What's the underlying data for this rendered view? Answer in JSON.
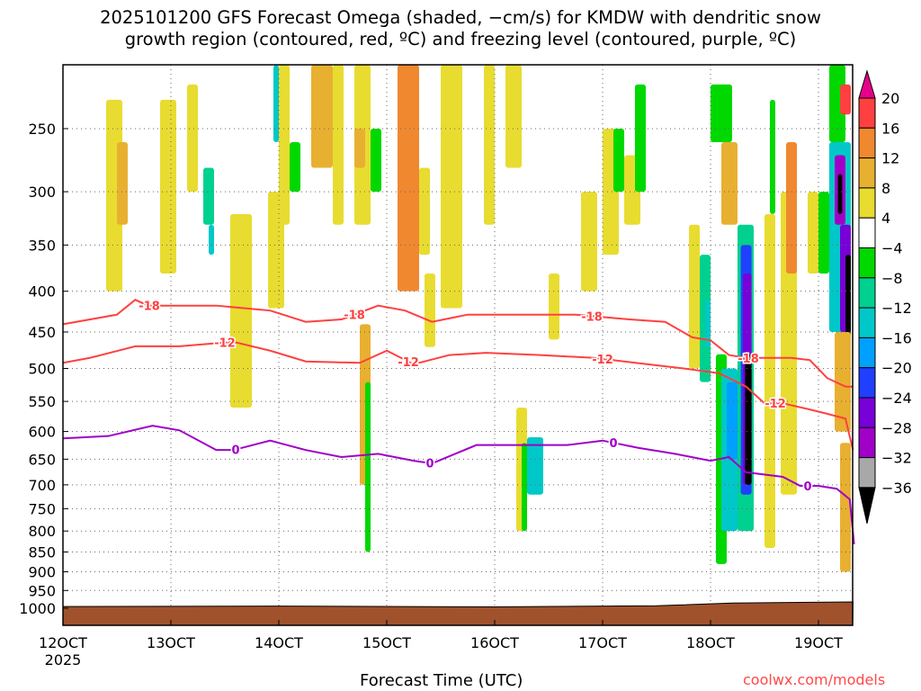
{
  "title": {
    "line1": "2025101200 GFS Forecast Omega (shaded, −cm/s) for KMDW with dendritic snow",
    "line2": "growth region (contoured, red, ºC) and freezing level (contoured, purple, ºC)"
  },
  "credit": "coolwx.com/models",
  "chart_data": {
    "type": "heatmap",
    "title": "2025101200 GFS Forecast Omega (shaded, −cm/s) for KMDW with dendritic snow growth region (contoured, red, ºC) and freezing level (contoured, purple, ºC)",
    "xlabel": "Forecast Time (UTC)",
    "ylabel": "",
    "xlim": [
      12.0,
      19.32
    ],
    "ylim_hpa": [
      1050,
      208
    ],
    "y_scale": "log",
    "x_ticks": [
      {
        "value": 12,
        "label": "12OCT"
      },
      {
        "value": 13,
        "label": "13OCT"
      },
      {
        "value": 14,
        "label": "14OCT"
      },
      {
        "value": 15,
        "label": "15OCT"
      },
      {
        "value": 16,
        "label": "16OCT"
      },
      {
        "value": 17,
        "label": "17OCT"
      },
      {
        "value": 18,
        "label": "18OCT"
      },
      {
        "value": 19,
        "label": "19OCT"
      }
    ],
    "x_sublabel": "2025",
    "y_ticks": [
      250,
      300,
      350,
      400,
      450,
      500,
      550,
      600,
      650,
      700,
      750,
      800,
      850,
      900,
      950,
      1000
    ],
    "grid": true,
    "colorbar": {
      "levels": [
        20,
        16,
        12,
        8,
        4,
        -4,
        -8,
        -12,
        -16,
        -20,
        -24,
        -28,
        -32,
        -36
      ],
      "colors": [
        "#e8008a",
        "#ff4040",
        "#f08830",
        "#e8b030",
        "#e8dc30",
        "#ffffff",
        "#00d800",
        "#00d090",
        "#00c8c8",
        "#00a0ff",
        "#2040ff",
        "#7800d8",
        "#a000c8",
        "#a8a8a8",
        "#000000"
      ]
    },
    "ground_color": "#a0522d",
    "surface_pressure": {
      "x": [
        12.0,
        14.0,
        16.0,
        17.5,
        18.2,
        19.32
      ],
      "p": [
        995,
        994,
        996,
        993,
        985,
        982
      ]
    },
    "contours": [
      {
        "name": "-18",
        "label": "-18",
        "color": "#ff4040",
        "x": [
          12.0,
          12.5,
          12.67,
          12.79,
          13.08,
          13.42,
          13.92,
          14.25,
          14.58,
          14.92,
          15.17,
          15.42,
          15.75,
          16.25,
          16.75,
          17.25,
          17.58,
          17.83,
          18.0,
          18.17,
          18.33,
          18.5,
          18.75,
          18.92,
          19.08,
          19.25,
          19.32
        ],
        "p": [
          440,
          428,
          410,
          417,
          417,
          417,
          423,
          437,
          434,
          417,
          423,
          437,
          428,
          428,
          428,
          434,
          437,
          457,
          461,
          481,
          485,
          485,
          485,
          488,
          514,
          527,
          527
        ],
        "labels_at": [
          12.8,
          14.7,
          16.9,
          18.35
        ]
      },
      {
        "name": "-12",
        "label": "-12",
        "color": "#ff4040",
        "x": [
          12.0,
          12.25,
          12.67,
          13.08,
          13.58,
          13.92,
          14.25,
          14.75,
          15.0,
          15.25,
          15.58,
          15.92,
          16.42,
          16.92,
          17.42,
          17.75,
          18.08,
          18.33,
          18.5,
          18.67,
          18.92,
          19.08,
          19.25,
          19.32
        ],
        "p": [
          492,
          485,
          469,
          469,
          463,
          475,
          490,
          492,
          475,
          494,
          481,
          478,
          481,
          485,
          494,
          500,
          507,
          527,
          553,
          553,
          563,
          570,
          578,
          633
        ],
        "labels_at": [
          13.5,
          15.2,
          17.0,
          18.6
        ]
      },
      {
        "name": "0",
        "label": "0",
        "color": "#a000c8",
        "x": [
          12.0,
          12.42,
          12.83,
          13.08,
          13.42,
          13.58,
          13.92,
          14.25,
          14.58,
          14.92,
          15.25,
          15.42,
          15.83,
          16.17,
          16.67,
          17.0,
          17.33,
          17.67,
          18.0,
          18.17,
          18.33,
          18.67,
          18.83,
          19.0,
          19.17,
          19.29,
          19.33
        ],
        "p": [
          612,
          608,
          590,
          598,
          633,
          633,
          616,
          633,
          646,
          640,
          653,
          658,
          624,
          624,
          624,
          616,
          629,
          640,
          653,
          646,
          675,
          684,
          702,
          702,
          708,
          730,
          831
        ],
        "labels_at": [
          13.6,
          15.4,
          17.1,
          18.9
        ]
      }
    ],
    "omega_patches": [
      {
        "x": [
          12.4,
          12.55
        ],
        "p": [
          230,
          400
        ],
        "value": 6
      },
      {
        "x": [
          12.5,
          12.6
        ],
        "p": [
          260,
          330
        ],
        "value": 10
      },
      {
        "x": [
          12.9,
          13.05
        ],
        "p": [
          230,
          380
        ],
        "value": 6
      },
      {
        "x": [
          13.15,
          13.25
        ],
        "p": [
          220,
          300
        ],
        "value": 6
      },
      {
        "x": [
          13.3,
          13.4
        ],
        "p": [
          280,
          330
        ],
        "value": -10
      },
      {
        "x": [
          13.35,
          13.4
        ],
        "p": [
          330,
          360
        ],
        "value": -16
      },
      {
        "x": [
          13.55,
          13.75
        ],
        "p": [
          320,
          560
        ],
        "value": 6
      },
      {
        "x": [
          13.9,
          14.05
        ],
        "p": [
          300,
          420
        ],
        "value": 6
      },
      {
        "x": [
          13.95,
          14.0
        ],
        "p": [
          208,
          260
        ],
        "value": -14
      },
      {
        "x": [
          14.0,
          14.1
        ],
        "p": [
          208,
          330
        ],
        "value": 6
      },
      {
        "x": [
          14.1,
          14.2
        ],
        "p": [
          260,
          300
        ],
        "value": -6
      },
      {
        "x": [
          14.3,
          14.5
        ],
        "p": [
          208,
          280
        ],
        "value": 10
      },
      {
        "x": [
          14.5,
          14.6
        ],
        "p": [
          208,
          330
        ],
        "value": 6
      },
      {
        "x": [
          14.7,
          14.85
        ],
        "p": [
          208,
          330
        ],
        "value": 6
      },
      {
        "x": [
          14.7,
          14.8
        ],
        "p": [
          250,
          280
        ],
        "value": 10
      },
      {
        "x": [
          14.75,
          14.85
        ],
        "p": [
          440,
          700
        ],
        "value": 8
      },
      {
        "x": [
          14.8,
          14.85
        ],
        "p": [
          520,
          850
        ],
        "value": -8
      },
      {
        "x": [
          14.85,
          14.95
        ],
        "p": [
          250,
          300
        ],
        "value": -6
      },
      {
        "x": [
          15.1,
          15.3
        ],
        "p": [
          208,
          400
        ],
        "value": 12
      },
      {
        "x": [
          15.3,
          15.4
        ],
        "p": [
          280,
          360
        ],
        "value": 6
      },
      {
        "x": [
          15.35,
          15.45
        ],
        "p": [
          380,
          470
        ],
        "value": 6
      },
      {
        "x": [
          15.5,
          15.7
        ],
        "p": [
          208,
          420
        ],
        "value": 6
      },
      {
        "x": [
          15.9,
          16.0
        ],
        "p": [
          208,
          330
        ],
        "value": 6
      },
      {
        "x": [
          16.1,
          16.25
        ],
        "p": [
          208,
          280
        ],
        "value": 6
      },
      {
        "x": [
          16.2,
          16.3
        ],
        "p": [
          560,
          800
        ],
        "value": 6
      },
      {
        "x": [
          16.25,
          16.3
        ],
        "p": [
          620,
          800
        ],
        "value": -6
      },
      {
        "x": [
          16.3,
          16.45
        ],
        "p": [
          610,
          720
        ],
        "value": -14
      },
      {
        "x": [
          16.5,
          16.6
        ],
        "p": [
          380,
          460
        ],
        "value": 6
      },
      {
        "x": [
          16.8,
          16.95
        ],
        "p": [
          300,
          400
        ],
        "value": 6
      },
      {
        "x": [
          17.0,
          17.15
        ],
        "p": [
          250,
          360
        ],
        "value": 6
      },
      {
        "x": [
          17.1,
          17.2
        ],
        "p": [
          250,
          300
        ],
        "value": -6
      },
      {
        "x": [
          17.2,
          17.35
        ],
        "p": [
          270,
          330
        ],
        "value": 6
      },
      {
        "x": [
          17.3,
          17.4
        ],
        "p": [
          220,
          300
        ],
        "value": -8
      },
      {
        "x": [
          17.8,
          17.9
        ],
        "p": [
          330,
          500
        ],
        "value": 6
      },
      {
        "x": [
          17.9,
          18.0
        ],
        "p": [
          360,
          520
        ],
        "value": -10
      },
      {
        "x": [
          17.95,
          18.0
        ],
        "p": [
          410,
          470
        ],
        "value": -14
      },
      {
        "x": [
          18.0,
          18.2
        ],
        "p": [
          220,
          260
        ],
        "value": -6
      },
      {
        "x": [
          18.1,
          18.25
        ],
        "p": [
          260,
          330
        ],
        "value": 10
      },
      {
        "x": [
          18.05,
          18.15
        ],
        "p": [
          480,
          880
        ],
        "value": -8
      },
      {
        "x": [
          18.1,
          18.25
        ],
        "p": [
          500,
          800
        ],
        "value": -14
      },
      {
        "x": [
          18.15,
          18.25
        ],
        "p": [
          520,
          650
        ],
        "value": -18
      },
      {
        "x": [
          18.25,
          18.4
        ],
        "p": [
          330,
          800
        ],
        "value": -10
      },
      {
        "x": [
          18.28,
          18.38
        ],
        "p": [
          350,
          720
        ],
        "value": -22
      },
      {
        "x": [
          18.3,
          18.38
        ],
        "p": [
          380,
          700
        ],
        "value": -28
      },
      {
        "x": [
          18.32,
          18.38
        ],
        "p": [
          480,
          700
        ],
        "value": -40
      },
      {
        "x": [
          18.5,
          18.6
        ],
        "p": [
          320,
          840
        ],
        "value": 6
      },
      {
        "x": [
          18.55,
          18.6
        ],
        "p": [
          230,
          320
        ],
        "value": -8
      },
      {
        "x": [
          18.65,
          18.8
        ],
        "p": [
          300,
          720
        ],
        "value": 6
      },
      {
        "x": [
          18.7,
          18.8
        ],
        "p": [
          260,
          380
        ],
        "value": 12
      },
      {
        "x": [
          18.9,
          19.0
        ],
        "p": [
          300,
          380
        ],
        "value": 6
      },
      {
        "x": [
          19.0,
          19.1
        ],
        "p": [
          300,
          380
        ],
        "value": -6
      },
      {
        "x": [
          19.1,
          19.25
        ],
        "p": [
          208,
          260
        ],
        "value": -8
      },
      {
        "x": [
          19.1,
          19.3
        ],
        "p": [
          260,
          450
        ],
        "value": -14
      },
      {
        "x": [
          19.15,
          19.25
        ],
        "p": [
          270,
          330
        ],
        "value": -32
      },
      {
        "x": [
          19.18,
          19.22
        ],
        "p": [
          285,
          320
        ],
        "value": -40
      },
      {
        "x": [
          19.2,
          19.3
        ],
        "p": [
          330,
          450
        ],
        "value": -28
      },
      {
        "x": [
          19.25,
          19.3
        ],
        "p": [
          360,
          500
        ],
        "value": -40
      },
      {
        "x": [
          19.15,
          19.3
        ],
        "p": [
          450,
          600
        ],
        "value": 8
      },
      {
        "x": [
          19.2,
          19.3
        ],
        "p": [
          620,
          900
        ],
        "value": 10
      },
      {
        "x": [
          19.2,
          19.3
        ],
        "p": [
          220,
          240
        ],
        "value": 16
      }
    ]
  }
}
